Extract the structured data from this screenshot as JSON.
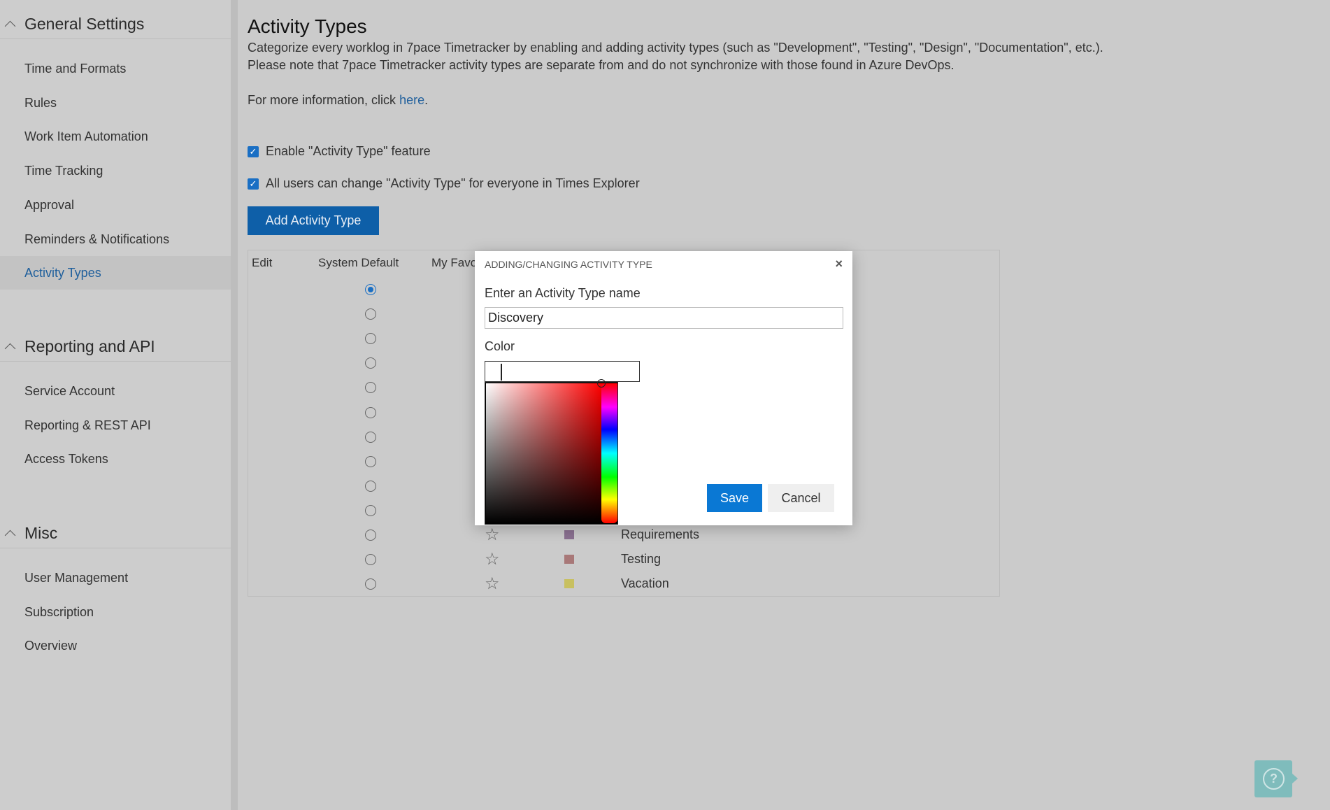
{
  "sidebar": {
    "sections": [
      {
        "title": "General Settings",
        "items": [
          "Time and Formats",
          "Rules",
          "Work Item Automation",
          "Time Tracking",
          "Approval",
          "Reminders & Notifications",
          "Activity Types"
        ]
      },
      {
        "title": "Reporting and API",
        "items": [
          "Service Account",
          "Reporting & REST API",
          "Access Tokens"
        ]
      },
      {
        "title": "Misc",
        "items": [
          "User Management",
          "Subscription",
          "Overview"
        ]
      }
    ],
    "active": "Activity Types"
  },
  "main": {
    "title": "Activity Types",
    "desc1": "Categorize every worklog in 7pace Timetracker by enabling and adding activity types (such as \"Development\", \"Testing\", \"Design\", \"Documentation\", etc.).",
    "desc2": "Please note that 7pace Timetracker activity types are separate from and do not synchronize with those found in Azure DevOps.",
    "more_prefix": "For more information, click ",
    "more_link": "here",
    "more_suffix": ".",
    "checkbox1": "Enable \"Activity Type\" feature",
    "checkbox1_checked": true,
    "checkbox2": "All users can change \"Activity Type\" for everyone in Times Explorer",
    "checkbox2_checked": true,
    "add_button": "Add Activity Type"
  },
  "table": {
    "headers": [
      "Edit",
      "System Default",
      "My Favo"
    ],
    "row_count": 13,
    "default_row": 0,
    "visible_rows": [
      {
        "name": "Requirements",
        "color": "#8a7090"
      },
      {
        "name": "Testing",
        "color": "#a87878"
      },
      {
        "name": "Vacation",
        "color": "#c8c060"
      }
    ]
  },
  "modal": {
    "title": "ADDING/CHANGING ACTIVITY TYPE",
    "close": "×",
    "name_label": "Enter an Activity Type name",
    "name_value": "Discovery",
    "color_label": "Color",
    "save": "Save",
    "cancel": "Cancel"
  },
  "help": {
    "icon": "question-icon",
    "label": "?"
  }
}
